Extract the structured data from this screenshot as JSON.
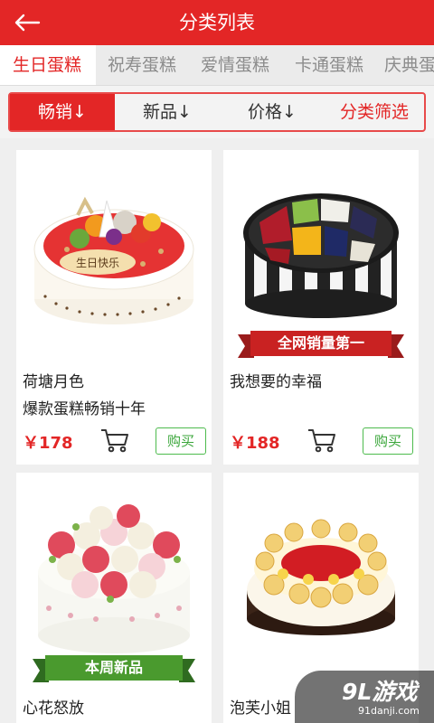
{
  "header": {
    "title": "分类列表",
    "back_icon": "arrow-left-icon"
  },
  "categories": [
    {
      "label": "生日蛋糕",
      "active": true
    },
    {
      "label": "祝寿蛋糕",
      "active": false
    },
    {
      "label": "爱情蛋糕",
      "active": false
    },
    {
      "label": "卡通蛋糕",
      "active": false
    },
    {
      "label": "庆典蛋",
      "active": false
    }
  ],
  "filters": {
    "bestseller": "畅销↓",
    "new": "新品↓",
    "price": "价格↓",
    "screen": "分类筛选"
  },
  "products": [
    {
      "name": "荷塘月色",
      "subtitle": "爆款蛋糕畅销十年",
      "price": "￥178",
      "buy_label": "购买",
      "badge": "",
      "plaque": "生日快乐"
    },
    {
      "name": "我想要的幸福",
      "subtitle": "",
      "price": "￥188",
      "buy_label": "购买",
      "badge": "全网销量第一"
    },
    {
      "name": "心花怒放",
      "subtitle": "",
      "price": "",
      "buy_label": "",
      "badge": "本周新品"
    },
    {
      "name": "泡芙小姐",
      "subtitle": "",
      "price": "",
      "buy_label": "",
      "badge": ""
    }
  ],
  "watermark": {
    "logo": "9L游戏",
    "url": "91danji.com"
  },
  "colors": {
    "brand_red": "#e32626",
    "buy_green": "#3aa63a",
    "badge_green": "#4a9a2e"
  }
}
